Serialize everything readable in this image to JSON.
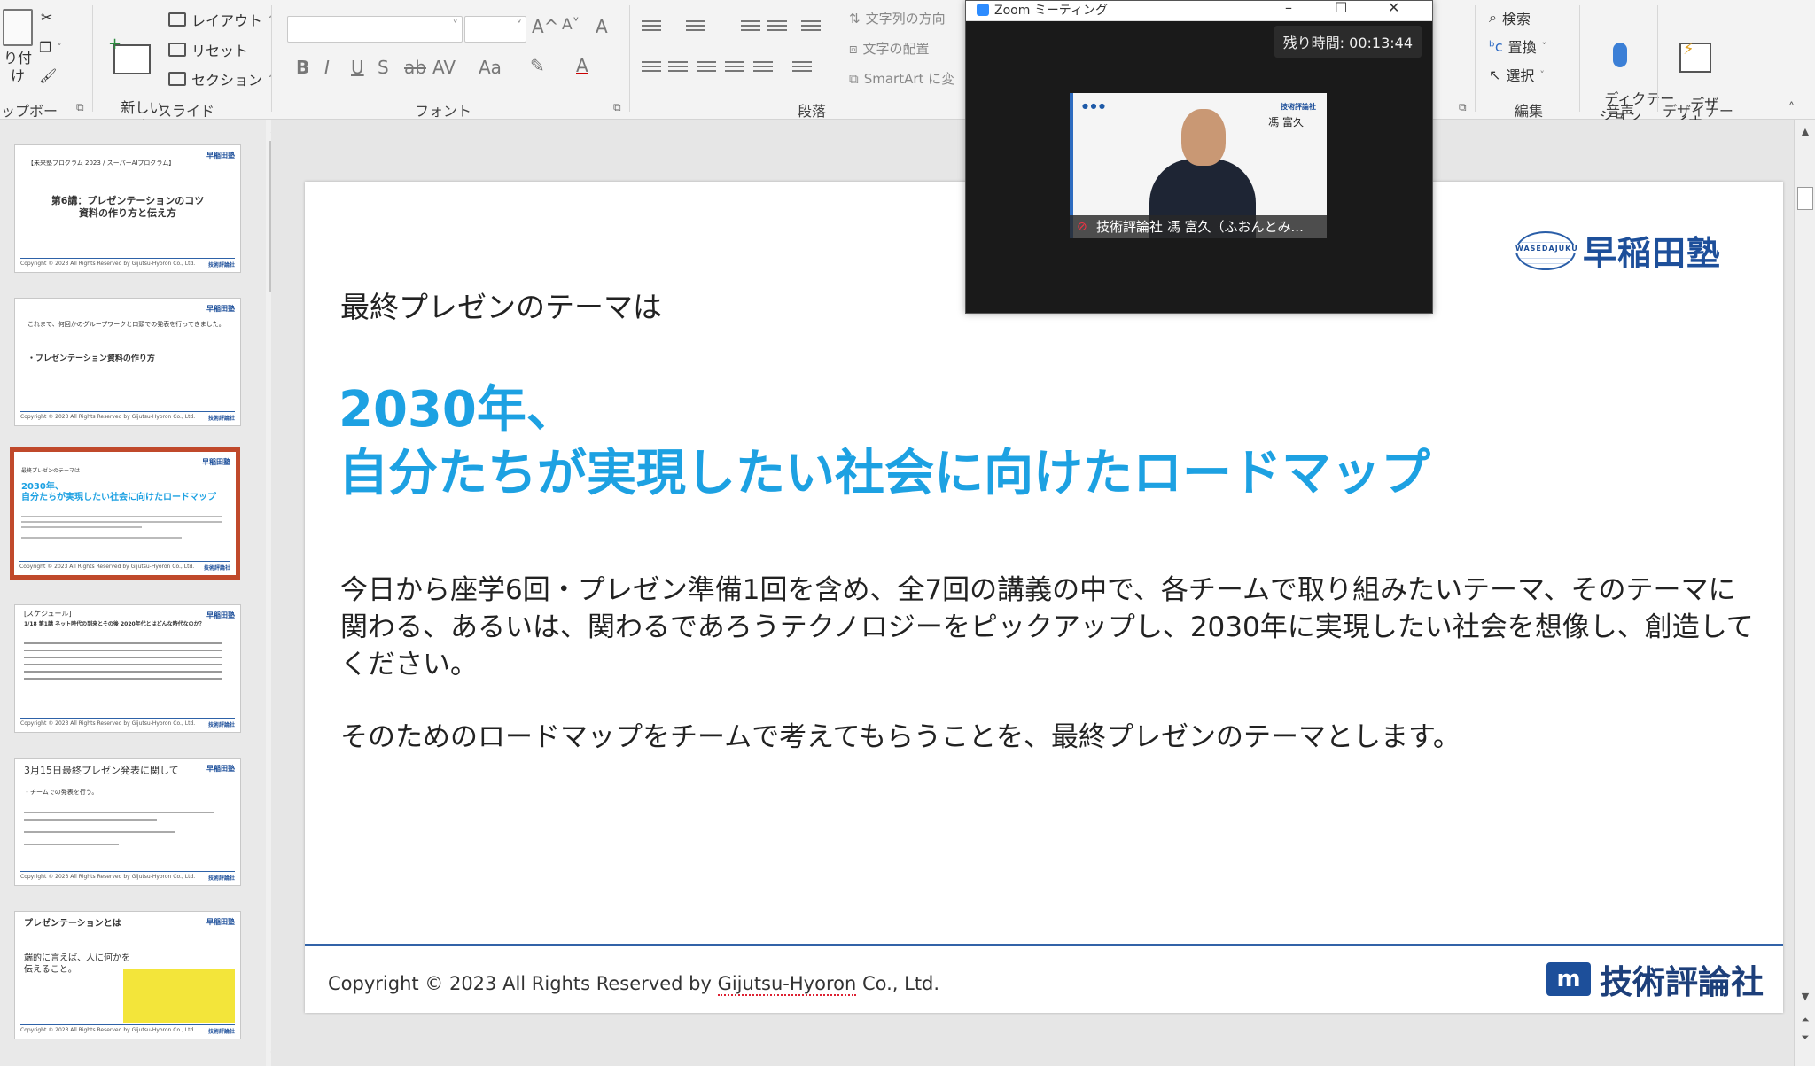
{
  "ribbon": {
    "clipboard": {
      "paste_label": "り付け",
      "group_label": "ップボード"
    },
    "slides": {
      "new_slide": "新しい\nスライド",
      "layout": "レイアウト",
      "reset": "リセット",
      "section": "セクション",
      "group_label": "スライド"
    },
    "font": {
      "font_name": "",
      "font_size": "",
      "grow": "A^",
      "shrink": "A˅",
      "clear": "A",
      "bold": "B",
      "italic": "I",
      "underline": "U",
      "shadow": "S",
      "strike": "ab",
      "spacing": "AV",
      "case": "Aa",
      "group_label": "フォント"
    },
    "paragraph": {
      "group_label": "段落",
      "text_direction": "文字列の方向",
      "align_text": "文字の配置",
      "smartart": "SmartArt に変"
    },
    "editing": {
      "find": "検索",
      "replace": "置換",
      "select": "選択",
      "group_label": "編集"
    },
    "voice": {
      "dictate": "ディクテー\nション",
      "group_label": "音声"
    },
    "designer": {
      "label": "デザ\nイナー",
      "group_label": "デザイナー"
    }
  },
  "thumbnails": [
    {
      "title": "第6講：プレゼンテーションのコツ\n資料の作り方と伝え方",
      "subtitle": "【未来塾プログラム 2023 / スーパーAIプログラム】",
      "logo": "早稲田塾"
    },
    {
      "title": "・プレゼンテーション資料の作り方",
      "subtitle": "これまで、何回かのグループワークと口頭での発表を行ってきました。",
      "logo": "早稲田塾"
    },
    {
      "title": "2030年、\n自分たちが実現したい社会に向けたロードマップ",
      "subtitle": "最終プレゼンのテーマは",
      "logo": "早稲田塾",
      "selected": true
    },
    {
      "title": "[スケジュール]",
      "subtitle": "1/18 第1講 ネット時代の到来とその後 2020年代とはどんな時代なのか？",
      "logo": "早稲田塾"
    },
    {
      "title": "3月15日最終プレゼン発表に関して",
      "subtitle": "・チームでの発表を行う。",
      "logo": "早稲田塾"
    },
    {
      "title": "プレゼンテーションとは",
      "subtitle": "端的に言えば、人に何かを伝えること。",
      "logo": "早稲田塾"
    }
  ],
  "thumb_footer": {
    "copy": "Copyright © 2023 All Rights Reserved by Gijutsu-Hyoron Co., Ltd.",
    "brand": "技術評論社"
  },
  "slide": {
    "subtitle": "最終プレゼンのテーマは",
    "title_line1": "2030年、",
    "title_line2": "自分たちが実現したい社会に向けたロードマップ",
    "body_p1": "今日から座学6回・プレゼン準備1回を含め、全7回の講義の中で、各チームで取り組みたいテーマ、そのテーマに関わる、あるいは、関わるであろうテクノロジーをピックアップし、2030年に実現したい社会を想像し、創造してください。",
    "body_p2": "そのためのロードマップをチームで考えてもらうことを、最終プレゼンのテーマとします。",
    "copyright_prefix": "Copyright © 2023 All Rights Reserved by ",
    "copyright_company": "Gijutsu-Hyoron",
    "copyright_suffix": " Co., Ltd.",
    "logo_waseda_en": "WASEDAJUKU",
    "logo_waseda_jp": "早稲田塾",
    "logo_gh_mark": "m",
    "logo_gh_jp": "技術評論社"
  },
  "zoom": {
    "window_title": "Zoom ミーティング",
    "timer": "残り時間: 00:13:44",
    "participant_name": "技術評論社 馮 富久（ふおんとみ...",
    "video_logo": "技術評論社",
    "video_person_jp": "馮 富久"
  },
  "colors": {
    "accent_title": "#1da1e2",
    "brand_blue": "#1d4f9a",
    "selection_border": "#c0492b"
  }
}
